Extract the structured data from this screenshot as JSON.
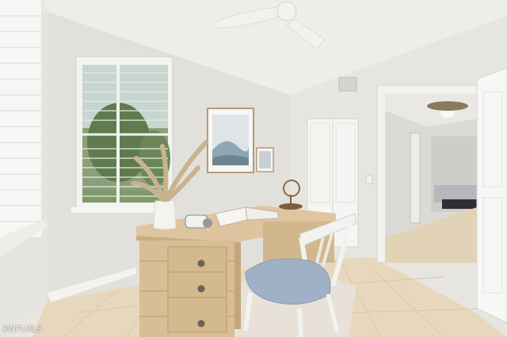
{
  "scene": {
    "description": "",
    "watermark": "SWFLMLS"
  },
  "colors": {
    "wall": "#e4e2dc",
    "ceiling": "#eeedea",
    "floor": "#e7d8bd",
    "desk": "#d8bd96",
    "chair_seat": "#9fb0c7",
    "chair_frame": "#f2f2f0"
  }
}
